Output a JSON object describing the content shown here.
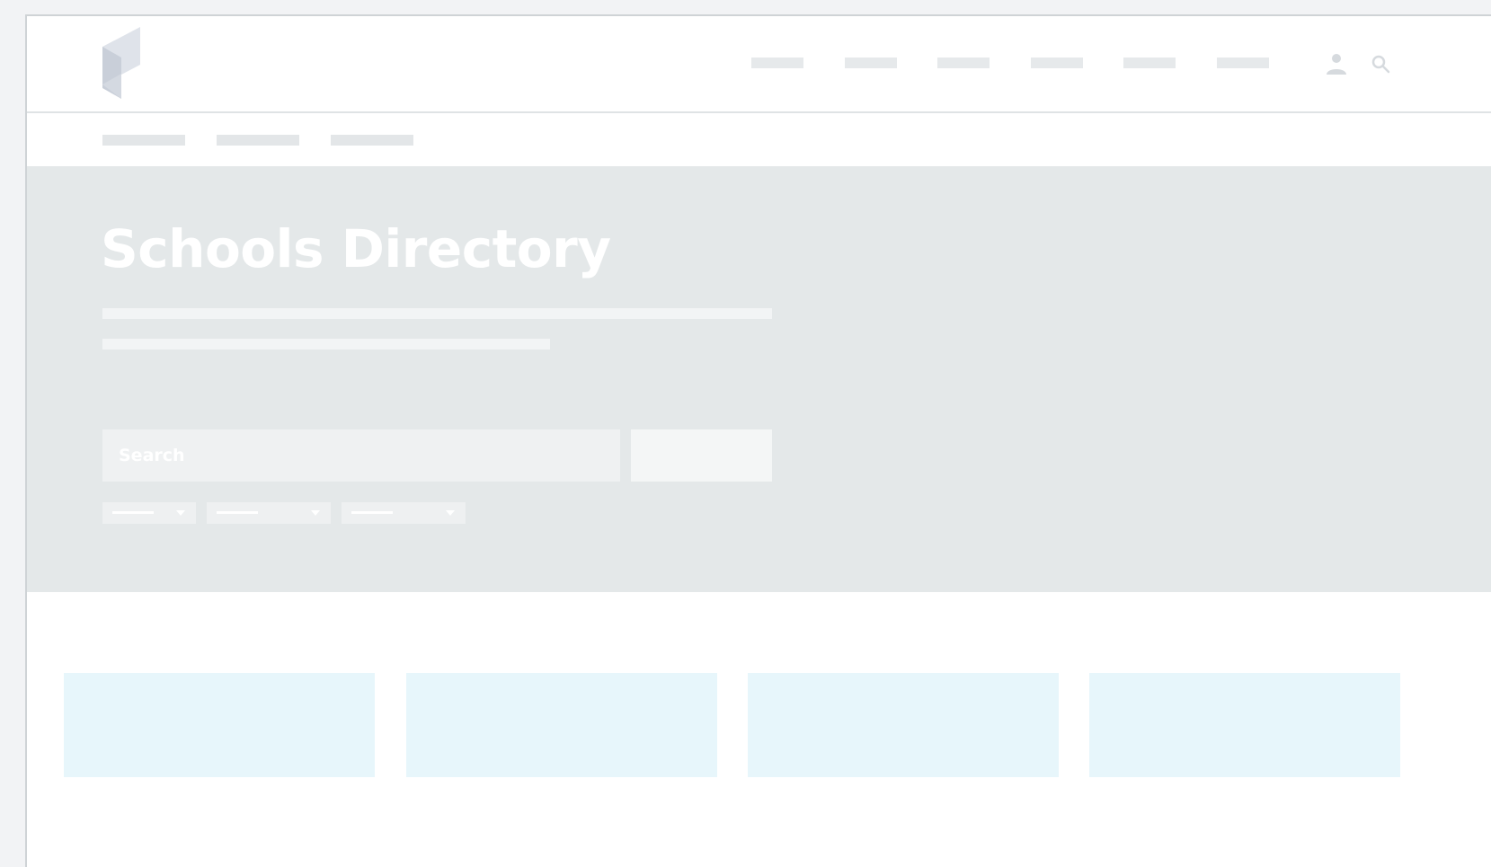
{
  "header": {
    "logo": "logo-mark",
    "nav_items": [
      "",
      "",
      "",
      "",
      "",
      ""
    ],
    "icons": [
      "user-icon",
      "search-icon"
    ]
  },
  "subnav": {
    "items": [
      "",
      "",
      ""
    ]
  },
  "hero": {
    "title": "Schools Directory",
    "search": {
      "placeholder": "Search",
      "value": "",
      "button_label": ""
    },
    "filters": [
      {
        "selected": ""
      },
      {
        "selected": ""
      },
      {
        "selected": ""
      }
    ]
  },
  "cards": [
    "",
    "",
    "",
    ""
  ],
  "colors": {
    "hero_bg": "#e4e8e9",
    "card_bg": "#e7f6fb",
    "placeholder_block": "#e6e9eb"
  }
}
